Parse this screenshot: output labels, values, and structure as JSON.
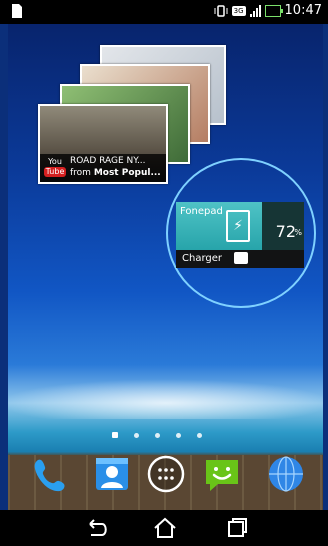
{
  "status_bar": {
    "time": "10:47",
    "network_badge": "3G",
    "icons": [
      "notification-document-icon",
      "vibrate-icon",
      "signal-icon",
      "battery-charging-icon"
    ]
  },
  "widgets": {
    "video_stack": {
      "source_logo": {
        "top": "You",
        "bottom": "Tube"
      },
      "title": "ROAD RAGE NY...",
      "subtitle_prefix": "from ",
      "subtitle_bold": "Most Popul..."
    },
    "battery": {
      "device_name": "Fonepad",
      "percent": "72",
      "percent_sign": "%",
      "charger_label": "Charger",
      "level_fraction": 0.72
    }
  },
  "home": {
    "page_count": 5,
    "current_page": 1
  },
  "dock": {
    "apps": [
      "phone",
      "contacts",
      "all-apps",
      "messaging",
      "browser"
    ]
  },
  "colors": {
    "accent_teal": "#27a4aa",
    "charge_green": "#7be06a",
    "highlight_ring": "#7fd1ff"
  }
}
